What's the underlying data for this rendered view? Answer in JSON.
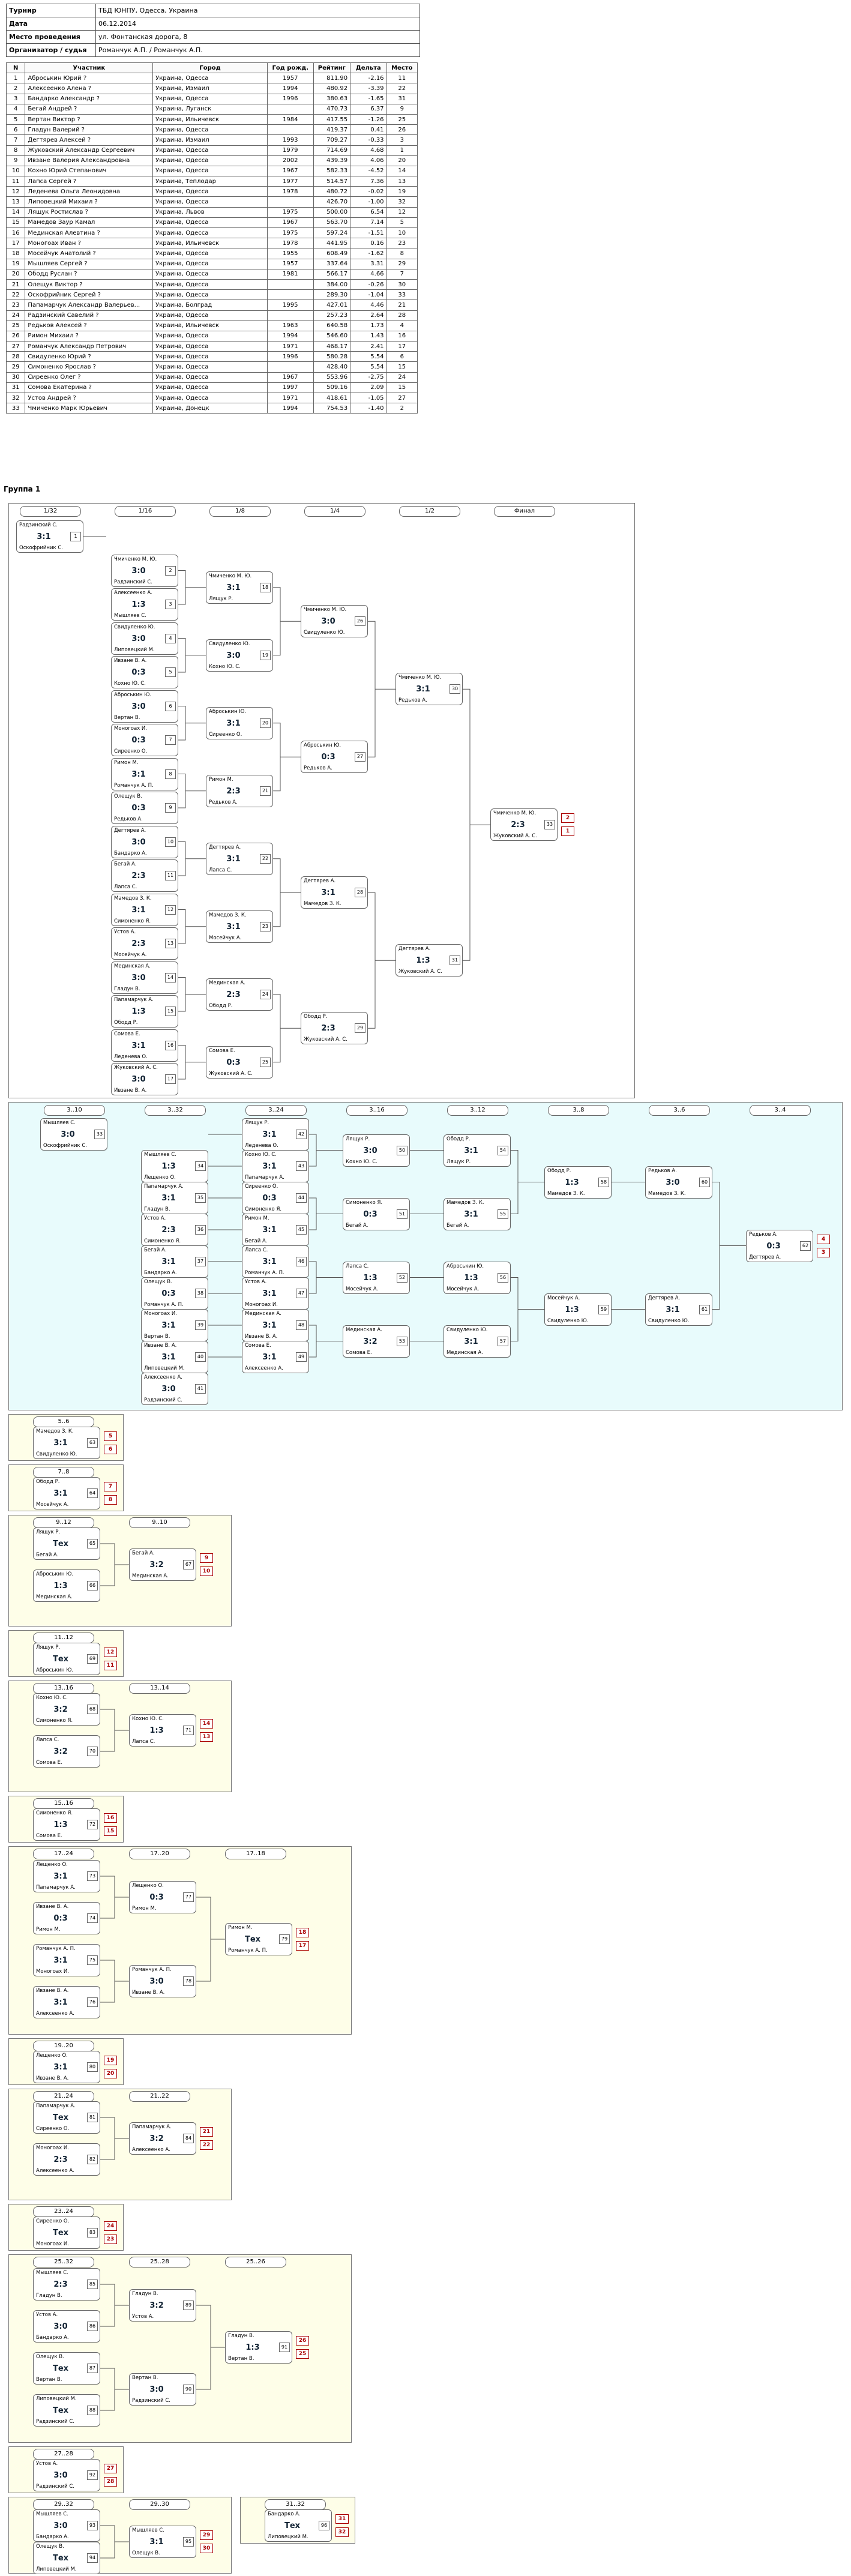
{
  "info": [
    {
      "k": "Турнир",
      "v": "ТБД ЮНПУ, Одесса, Украина"
    },
    {
      "k": "Дата",
      "v": "06.12.2014"
    },
    {
      "k": "Место проведения",
      "v": "ул. Фонтанская дорога, 8"
    },
    {
      "k": "Организатор / судья",
      "v": "Романчук А.П. / Романчук А.П."
    }
  ],
  "players_head": [
    "N",
    "Участник",
    "Город",
    "Год рожд.",
    "Рейтинг",
    "Дельта",
    "Место"
  ],
  "players": [
    [
      "1",
      "Аброськин Юрий ?",
      "Украина, Одесса",
      "1957",
      "811.90",
      "-2.16",
      "11"
    ],
    [
      "2",
      "Алексеенко Алена ?",
      "Украина, Измаил",
      "1994",
      "480.92",
      "-3.39",
      "22"
    ],
    [
      "3",
      "Бандарко Александр ?",
      "Украина, Одесса",
      "1996",
      "380.63",
      "-1.65",
      "31"
    ],
    [
      "4",
      "Бегай Андрей ?",
      "Украина, Луганск",
      "",
      "470.73",
      "6.37",
      "9"
    ],
    [
      "5",
      "Вертан Виктор ?",
      "Украина, Ильичевск",
      "1984",
      "417.55",
      "-1.26",
      "25"
    ],
    [
      "6",
      "Гладун Валерий ?",
      "Украина, Одесса",
      "",
      "419.37",
      "0.41",
      "26"
    ],
    [
      "7",
      "Дегтярев Алексей ?",
      "Украина, Измаил",
      "1993",
      "709.27",
      "-0.33",
      "3"
    ],
    [
      "8",
      "Жуковский Александр Сергеевич",
      "Украина, Одесса",
      "1979",
      "714.69",
      "4.68",
      "1"
    ],
    [
      "9",
      "Ивзане Валерия Александровна",
      "Украина, Одесса",
      "2002",
      "439.39",
      "4.06",
      "20"
    ],
    [
      "10",
      "Кохно Юрий Степанович",
      "Украина, Одесса",
      "1967",
      "582.33",
      "-4.52",
      "14"
    ],
    [
      "11",
      "Лапса Сергей ?",
      "Украина, Теплодар",
      "1977",
      "514.57",
      "7.36",
      "13"
    ],
    [
      "12",
      "Леденева Ольга Леонидовна",
      "Украина, Одесса",
      "1978",
      "480.72",
      "-0.02",
      "19"
    ],
    [
      "13",
      "Липовецкий Михаил ?",
      "Украина, Одесса",
      "",
      "426.70",
      "-1.00",
      "32"
    ],
    [
      "14",
      "Лящук Ростислав ?",
      "Украина, Львов",
      "1975",
      "500.00",
      "6.54",
      "12"
    ],
    [
      "15",
      "Мамедов Заур Камал",
      "Украина, Одесса",
      "1967",
      "563.70",
      "7.14",
      "5"
    ],
    [
      "16",
      "Мединская Алевтина ?",
      "Украина, Одесса",
      "1975",
      "597.24",
      "-1.51",
      "10"
    ],
    [
      "17",
      "Моногоах Иван ?",
      "Украина, Ильичевск",
      "1978",
      "441.95",
      "0.16",
      "23"
    ],
    [
      "18",
      "Мосейчук Анатолий ?",
      "Украина, Одесса",
      "1955",
      "608.49",
      "-1.62",
      "8"
    ],
    [
      "19",
      "Мышляев Сергей ?",
      "Украина, Одесса",
      "1957",
      "337.64",
      "3.31",
      "29"
    ],
    [
      "20",
      "Ободд Руслан ?",
      "Украина, Одесса",
      "1981",
      "566.17",
      "4.66",
      "7"
    ],
    [
      "21",
      "Олещук Виктор ?",
      "Украина, Одесса",
      "",
      "384.00",
      "-0.26",
      "30"
    ],
    [
      "22",
      "Оскофрийник Сергей ?",
      "Украина, Одесса",
      "",
      "289.30",
      "-1.04",
      "33"
    ],
    [
      "23",
      "Папамарчук Александр Валерьев...",
      "Украина, Болград",
      "1995",
      "427.01",
      "4.46",
      "21"
    ],
    [
      "24",
      "Радзинский Савелий ?",
      "Украина, Одесса",
      "",
      "257.23",
      "2.64",
      "28"
    ],
    [
      "25",
      "Редьков Алексей ?",
      "Украина, Ильичевск",
      "1963",
      "640.58",
      "1.73",
      "4"
    ],
    [
      "26",
      "Римон Михаил ?",
      "Украина, Одесса",
      "1994",
      "546.60",
      "1.43",
      "16"
    ],
    [
      "27",
      "Романчук Александр Петрович",
      "Украина, Одесса",
      "1971",
      "468.17",
      "2.41",
      "17"
    ],
    [
      "28",
      "Свидуленко Юрий ?",
      "Украина, Одесса",
      "1996",
      "580.28",
      "5.54",
      "6"
    ],
    [
      "29",
      "Симоненко Ярослав ?",
      "Украина, Одесса",
      "",
      "428.40",
      "5.54",
      "15"
    ],
    [
      "30",
      "Сиреенко Олег ?",
      "Украина, Одесса",
      "1967",
      "553.96",
      "-2.75",
      "24"
    ],
    [
      "31",
      "Сомова Екатерина ?",
      "Украина, Одесса",
      "1997",
      "509.16",
      "2.09",
      "15"
    ],
    [
      "32",
      "Устов Андрей ?",
      "Украина, Одесса",
      "1971",
      "418.61",
      "-1.05",
      "27"
    ],
    [
      "33",
      "Чмиченко Марк Юрьевич",
      "Украина, Донецк",
      "1994",
      "754.53",
      "-1.40",
      "2"
    ]
  ],
  "group_title": "Группа 1",
  "main_cols": [
    "1/32",
    "1/16",
    "1/8",
    "1/4",
    "1/2",
    "Финал"
  ],
  "main_r1": [
    {
      "p1": "Радзинский С.",
      "p2": "Оскофрийник С.",
      "sc": "3:1",
      "n": "1"
    },
    {
      "p1": "Чмиченко М. Ю.",
      "p2": "Радзинский С.",
      "sc": "3:0",
      "n": "2"
    },
    {
      "p1": "Алексеенко А.",
      "p2": "Мышляев С.",
      "sc": "1:3",
      "n": "3"
    },
    {
      "p1": "Свидуленко Ю.",
      "p2": "Липовецкий М.",
      "sc": "3:0",
      "n": "4"
    },
    {
      "p1": "Ивзане В. А.",
      "p2": "Кохно Ю. С.",
      "sc": "0:3",
      "n": "5"
    },
    {
      "p1": "Аброськин Ю.",
      "p2": "Вертан В.",
      "sc": "3:0",
      "n": "6"
    },
    {
      "p1": "Моногоах И.",
      "p2": "Сиреенко О.",
      "sc": "0:3",
      "n": "7"
    },
    {
      "p1": "Римон М.",
      "p2": "Романчук А. П.",
      "sc": "3:1",
      "n": "8"
    },
    {
      "p1": "Олещук В.",
      "p2": "Редьков А.",
      "sc": "0:3",
      "n": "9"
    },
    {
      "p1": "Дегтярев А.",
      "p2": "Бандарко А.",
      "sc": "3:0",
      "n": "10"
    },
    {
      "p1": "Бегай А.",
      "p2": "Лапса С.",
      "sc": "2:3",
      "n": "11"
    },
    {
      "p1": "Мамедов З. К.",
      "p2": "Симоненко Я.",
      "sc": "3:1",
      "n": "12"
    },
    {
      "p1": "Устов А.",
      "p2": "Мосейчук А.",
      "sc": "2:3",
      "n": "13"
    },
    {
      "p1": "Мединская А.",
      "p2": "Гладун В.",
      "sc": "3:0",
      "n": "14"
    },
    {
      "p1": "Папамарчук А.",
      "p2": "Ободд Р.",
      "sc": "1:3",
      "n": "15"
    },
    {
      "p1": "Сомова Е.",
      "p2": "Леденева О.",
      "sc": "3:1",
      "n": "16"
    },
    {
      "p1": "Жуковский А. С.",
      "p2": "Ивзане В. А.",
      "sc": "3:0",
      "n": "17"
    }
  ],
  "main_r2": [
    {
      "p1": "Чмиченко М. Ю.",
      "p2": "Лящук Р.",
      "sc": "3:1",
      "n": "18"
    },
    {
      "p1": "Свидуленко Ю.",
      "p2": "Кохно Ю. С.",
      "sc": "3:0",
      "n": "19"
    },
    {
      "p1": "Аброськин Ю.",
      "p2": "Сиреенко О.",
      "sc": "3:1",
      "n": "20"
    },
    {
      "p1": "Римон М.",
      "p2": "Редьков А.",
      "sc": "2:3",
      "n": "21"
    },
    {
      "p1": "Дегтярев А.",
      "p2": "Лапса С.",
      "sc": "3:1",
      "n": "22"
    },
    {
      "p1": "Мамедов З. К.",
      "p2": "Мосейчук А.",
      "sc": "3:1",
      "n": "23"
    },
    {
      "p1": "Мединская А.",
      "p2": "Ободд Р.",
      "sc": "2:3",
      "n": "24"
    },
    {
      "p1": "Сомова Е.",
      "p2": "Жуковский А. С.",
      "sc": "0:3",
      "n": "25"
    }
  ],
  "main_r3": [
    {
      "p1": "Чмиченко М. Ю.",
      "p2": "Свидуленко Ю.",
      "sc": "3:0",
      "n": "26"
    },
    {
      "p1": "Аброськин Ю.",
      "p2": "Редьков А.",
      "sc": "0:3",
      "n": "27"
    },
    {
      "p1": "Дегтярев А.",
      "p2": "Мамедов З. К.",
      "sc": "3:1",
      "n": "28"
    },
    {
      "p1": "Ободд Р.",
      "p2": "Жуковский А. С.",
      "sc": "2:3",
      "n": "29"
    }
  ],
  "main_r4": [
    {
      "p1": "Чмиченко М. Ю.",
      "p2": "Редьков А.",
      "sc": "3:1",
      "n": "30"
    },
    {
      "p1": "Дегтярев А.",
      "p2": "Жуковский А. С.",
      "sc": "1:3",
      "n": "31"
    }
  ],
  "main_final": {
    "p1": "Чмиченко М. Ю.",
    "p2": "Жуковский А. С.",
    "sc": "2:3",
    "n": "33",
    "pl1": "2",
    "pl2": "1"
  },
  "cons_cols": [
    "3..10",
    "3..32",
    "3..24",
    "3..16",
    "3..12",
    "3..8",
    "3..6",
    "3..4"
  ],
  "cons_a": [
    {
      "p1": "Мышляев С.",
      "p2": "Оскофрийник С.",
      "sc": "3:0",
      "n": "33"
    },
    {
      "p1": "Мышляев С.",
      "p2": "Лещенко О.",
      "sc": "1:3",
      "n": "34"
    },
    {
      "p1": "Папамарчук А.",
      "p2": "Гладун В.",
      "sc": "3:1",
      "n": "35"
    },
    {
      "p1": "Устов А.",
      "p2": "Симоненко Я.",
      "sc": "2:3",
      "n": "36"
    },
    {
      "p1": "Бегай А.",
      "p2": "Бандарко А.",
      "sc": "3:1",
      "n": "37"
    },
    {
      "p1": "Олещук В.",
      "p2": "Романчук А. П.",
      "sc": "0:3",
      "n": "38"
    },
    {
      "p1": "Моногоах И.",
      "p2": "Вертан В.",
      "sc": "3:1",
      "n": "39"
    },
    {
      "p1": "Ивзане В. А.",
      "p2": "Липовецкий М.",
      "sc": "3:1",
      "n": "40"
    },
    {
      "p1": "Алексеенко А.",
      "p2": "Радзинский С.",
      "sc": "3:0",
      "n": "41"
    }
  ],
  "cons_b": [
    {
      "p1": "Лящук Р.",
      "p2": "Леденева О.",
      "sc": "3:1",
      "n": "42"
    },
    {
      "p1": "Кохно Ю. С.",
      "p2": "Папамарчук А.",
      "sc": "3:1",
      "n": "43"
    },
    {
      "p1": "Сиреенко О.",
      "p2": "Симоненко Я.",
      "sc": "0:3",
      "n": "44"
    },
    {
      "p1": "Римон М.",
      "p2": "Бегай А.",
      "sc": "3:1",
      "n": "45"
    },
    {
      "p1": "Лапса С.",
      "p2": "Романчук А. П.",
      "sc": "3:1",
      "n": "46"
    },
    {
      "p1": "Устов А.",
      "p2": "Моногоах И.",
      "sc": "3:1",
      "n": "47"
    },
    {
      "p1": "Мединская А.",
      "p2": "Ивзане В. А.",
      "sc": "3:1",
      "n": "48"
    },
    {
      "p1": "Сомова Е.",
      "p2": "Алексеенко А.",
      "sc": "3:1",
      "n": "49"
    }
  ],
  "cons_c": [
    {
      "p1": "Лящук Р.",
      "p2": "Кохно Ю. С.",
      "sc": "3:0",
      "n": "50"
    },
    {
      "p1": "Симоненко Я.",
      "p2": "Бегай А.",
      "sc": "0:3",
      "n": "51"
    },
    {
      "p1": "Лапса С.",
      "p2": "Мосейчук А.",
      "sc": "1:3",
      "n": "52"
    },
    {
      "p1": "Мединская А.",
      "p2": "Сомова Е.",
      "sc": "3:2",
      "n": "53"
    }
  ],
  "cons_d": [
    {
      "p1": "Ободд Р.",
      "p2": "Лящук Р.",
      "sc": "3:1",
      "n": "54"
    },
    {
      "p1": "Мамедов З. К.",
      "p2": "Бегай А.",
      "sc": "3:1",
      "n": "55"
    },
    {
      "p1": "Аброськин Ю.",
      "p2": "Мосейчук А.",
      "sc": "1:3",
      "n": "56"
    },
    {
      "p1": "Свидуленко Ю.",
      "p2": "Мединская А.",
      "sc": "3:1",
      "n": "57"
    }
  ],
  "cons_e": [
    {
      "p1": "Ободд Р.",
      "p2": "Мамедов З. К.",
      "sc": "1:3",
      "n": "58"
    },
    {
      "p1": "Мосейчук А.",
      "p2": "Свидуленко Ю.",
      "sc": "1:3",
      "n": "59"
    }
  ],
  "cons_f": [
    {
      "p1": "Редьков А.",
      "p2": "Мамедов З. К.",
      "sc": "3:0",
      "n": "60"
    },
    {
      "p1": "Дегтярев А.",
      "p2": "Свидуленко Ю.",
      "sc": "3:1",
      "n": "61"
    }
  ],
  "cons_final": {
    "p1": "Редьков А.",
    "p2": "Дегтярев А.",
    "sc": "0:3",
    "n": "62",
    "pl1": "4",
    "pl2": "3"
  },
  "small": [
    {
      "title": "5..6",
      "p1": "Мамедов З. К.",
      "p2": "Свидуленко Ю.",
      "sc": "3:1",
      "n": "63",
      "pl1": "5",
      "pl2": "6"
    },
    {
      "title": "7..8",
      "p1": "Ободд Р.",
      "p2": "Мосейчук А.",
      "sc": "3:1",
      "n": "64",
      "pl1": "7",
      "pl2": "8"
    },
    {
      "title": "11..12",
      "p1": "Лящук Р.",
      "p2": "Аброськин Ю.",
      "sc": "Тех",
      "n": "69",
      "pl1": "12",
      "pl2": "11"
    },
    {
      "title": "15..16",
      "p1": "Симоненко Я.",
      "p2": "Сомова Е.",
      "sc": "1:3",
      "n": "72",
      "pl1": "16",
      "pl2": "15"
    },
    {
      "title": "19..20",
      "p1": "Лещенко О.",
      "p2": "Ивзане В. А.",
      "sc": "3:1",
      "n": "80",
      "pl1": "19",
      "pl2": "20"
    },
    {
      "title": "23..24",
      "p1": "Сиреенко О.",
      "p2": "Моногоах И.",
      "sc": "Тех",
      "n": "83",
      "pl1": "24",
      "pl2": "23"
    },
    {
      "title": "27..28",
      "p1": "Устов А.",
      "p2": "Радзинский С.",
      "sc": "3:0",
      "n": "92",
      "pl1": "27",
      "pl2": "28"
    },
    {
      "title": "31..32",
      "p1": "Бандарко А.",
      "p2": "Липовецкий М.",
      "sc": "Тех",
      "n": "96",
      "pl1": "31",
      "pl2": "32"
    }
  ],
  "mid": [
    {
      "title": "9..12",
      "t2": "9..10",
      "a1": {
        "p1": "Лящук Р.",
        "p2": "Бегай А.",
        "sc": "Тех",
        "n": "65"
      },
      "a2": {
        "p1": "Аброськин Ю.",
        "p2": "Мединская А.",
        "sc": "1:3",
        "n": "66"
      },
      "f": {
        "p1": "Бегай А.",
        "p2": "Мединская А.",
        "sc": "3:2",
        "n": "67",
        "pl1": "9",
        "pl2": "10"
      }
    },
    {
      "title": "13..16",
      "t2": "13..14",
      "a1": {
        "p1": "Кохно Ю. С.",
        "p2": "Симоненко Я.",
        "sc": "3:2",
        "n": "68"
      },
      "a2": {
        "p1": "Лапса С.",
        "p2": "Сомова Е.",
        "sc": "3:2",
        "n": "70"
      },
      "f": {
        "p1": "Кохно Ю. С.",
        "p2": "Лапса С.",
        "sc": "1:3",
        "n": "71",
        "pl1": "14",
        "pl2": "13"
      }
    },
    {
      "title": "21..24",
      "t2": "21..22",
      "a1": {
        "p1": "Папамарчук А.",
        "p2": "Сиреенко О.",
        "sc": "Тех",
        "n": "81"
      },
      "a2": {
        "p1": "Моногоах И.",
        "p2": "Алексеенко А.",
        "sc": "2:3",
        "n": "82"
      },
      "f": {
        "p1": "Папамарчук А.",
        "p2": "Алексеенко А.",
        "sc": "3:2",
        "n": "84",
        "pl1": "21",
        "pl2": "22"
      }
    },
    {
      "title": "29..32",
      "t2": "29..30",
      "a1": {
        "p1": "Мышляев С.",
        "p2": "Бандарко А.",
        "sc": "3:0",
        "n": "93"
      },
      "a2": {
        "p1": "Олещук В.",
        "p2": "Липовецкий М.",
        "sc": "Тех",
        "n": "94"
      },
      "f": {
        "p1": "Мышляев С.",
        "p2": "Олещук В.",
        "sc": "3:1",
        "n": "95",
        "pl1": "29",
        "pl2": "30"
      }
    }
  ],
  "big": [
    {
      "titles": [
        "17..24",
        "17..20",
        "17..18"
      ],
      "r1": [
        {
          "p1": "Лещенко О.",
          "p2": "Папамарчук А.",
          "sc": "3:1",
          "n": "73"
        },
        {
          "p1": "Ивзане В. А.",
          "p2": "Римон М.",
          "sc": "0:3",
          "n": "74"
        },
        {
          "p1": "Романчук А. П.",
          "p2": "Моногоах И.",
          "sc": "3:1",
          "n": "75"
        },
        {
          "p1": "Ивзане В. А.",
          "p2": "Алексеенко А.",
          "sc": "3:1",
          "n": "76"
        }
      ],
      "r2": [
        {
          "p1": "Лещенко О.",
          "p2": "Римон М.",
          "sc": "0:3",
          "n": "77"
        },
        {
          "p1": "Романчук А. П.",
          "p2": "Ивзане В. А.",
          "sc": "3:0",
          "n": "78"
        }
      ],
      "f": {
        "p1": "Римон М.",
        "p2": "Романчук А. П.",
        "sc": "Тех",
        "n": "79",
        "pl1": "18",
        "pl2": "17"
      }
    },
    {
      "titles": [
        "25..32",
        "25..28",
        "25..26"
      ],
      "r1": [
        {
          "p1": "Мышляев С.",
          "p2": "Гладун В.",
          "sc": "2:3",
          "n": "85"
        },
        {
          "p1": "Устов А.",
          "p2": "Бандарко А.",
          "sc": "3:0",
          "n": "86"
        },
        {
          "p1": "Олещук В.",
          "p2": "Вертан В.",
          "sc": "Тех",
          "n": "87"
        },
        {
          "p1": "Липовецкий М.",
          "p2": "Радзинский С.",
          "sc": "Тех",
          "n": "88"
        }
      ],
      "r2": [
        {
          "p1": "Гладун В.",
          "p2": "Устов А.",
          "sc": "3:2",
          "n": "89"
        },
        {
          "p1": "Вертан В.",
          "p2": "Радзинский С.",
          "sc": "3:0",
          "n": "90"
        }
      ],
      "f": {
        "p1": "Гладун В.",
        "p2": "Вертан В.",
        "sc": "1:3",
        "n": "91",
        "pl1": "26",
        "pl2": "25"
      }
    }
  ]
}
